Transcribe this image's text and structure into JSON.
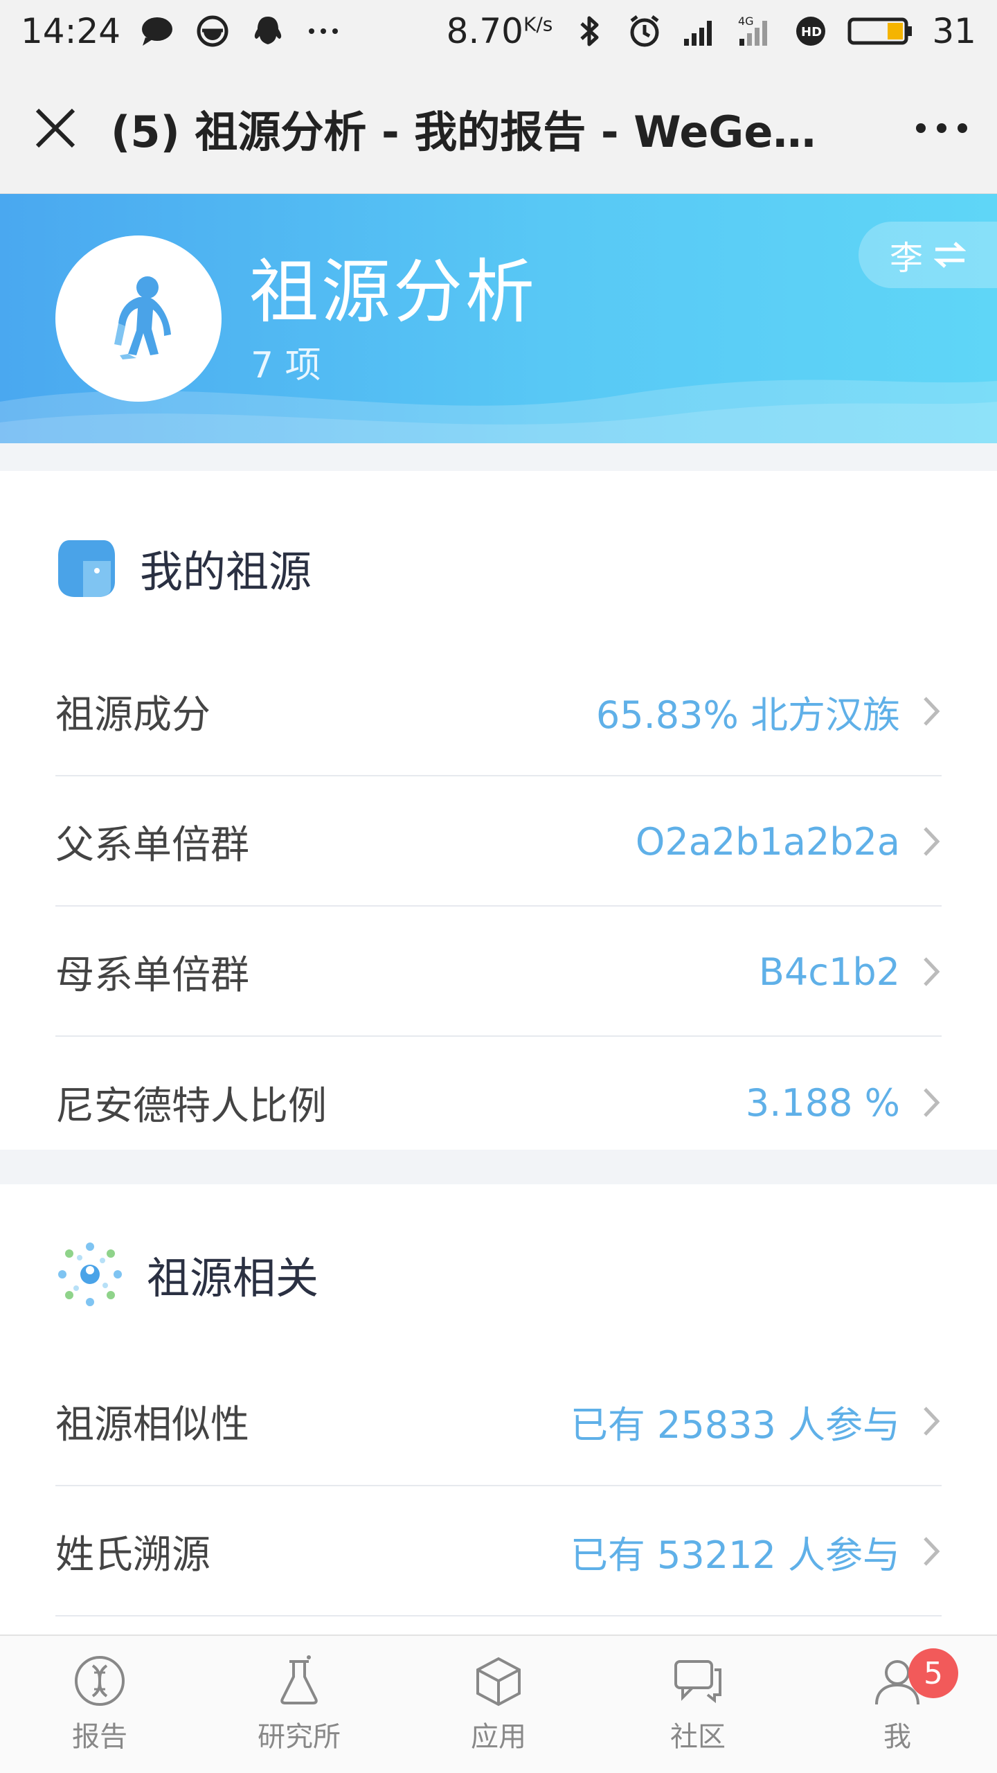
{
  "status_bar": {
    "time": "14:24",
    "net_speed": "8.70",
    "net_unit": "K/s",
    "battery": "31",
    "icons": [
      "chat-bubble-icon",
      "face-icon",
      "qq-icon",
      "more-dots-icon",
      "bluetooth-icon",
      "alarm-icon",
      "signal-icon",
      "4g-signal-icon",
      "hd-icon",
      "battery-icon"
    ]
  },
  "title_bar": {
    "title": "(5) 祖源分析 - 我的报告 - WeGen…"
  },
  "banner": {
    "title": "祖源分析",
    "count": "7 项",
    "switch_label": "李",
    "colors": {
      "start": "#4aa8f0",
      "end": "#5fd6f7"
    }
  },
  "section1": {
    "title": "我的祖源",
    "rows": [
      {
        "label": "祖源成分",
        "value": "65.83% 北方汉族"
      },
      {
        "label": "父系单倍群",
        "value": "O2a2b1a2b2a"
      },
      {
        "label": "母系单倍群",
        "value": "B4c1b2"
      },
      {
        "label": "尼安德特人比例",
        "value": "3.188 %"
      }
    ]
  },
  "section2": {
    "title": "祖源相关",
    "rows": [
      {
        "label": "祖源相似性",
        "value": "已有 25833 人参与"
      },
      {
        "label": "姓氏溯源",
        "value": "已有 53212 人参与"
      }
    ]
  },
  "tabs": [
    {
      "label": "报告",
      "icon": "dna-report-icon"
    },
    {
      "label": "研究所",
      "icon": "flask-icon"
    },
    {
      "label": "应用",
      "icon": "cube-icon"
    },
    {
      "label": "社区",
      "icon": "chat-icon"
    },
    {
      "label": "我",
      "icon": "person-icon",
      "badge": "5"
    }
  ],
  "accent_color": "#5fb0e8"
}
